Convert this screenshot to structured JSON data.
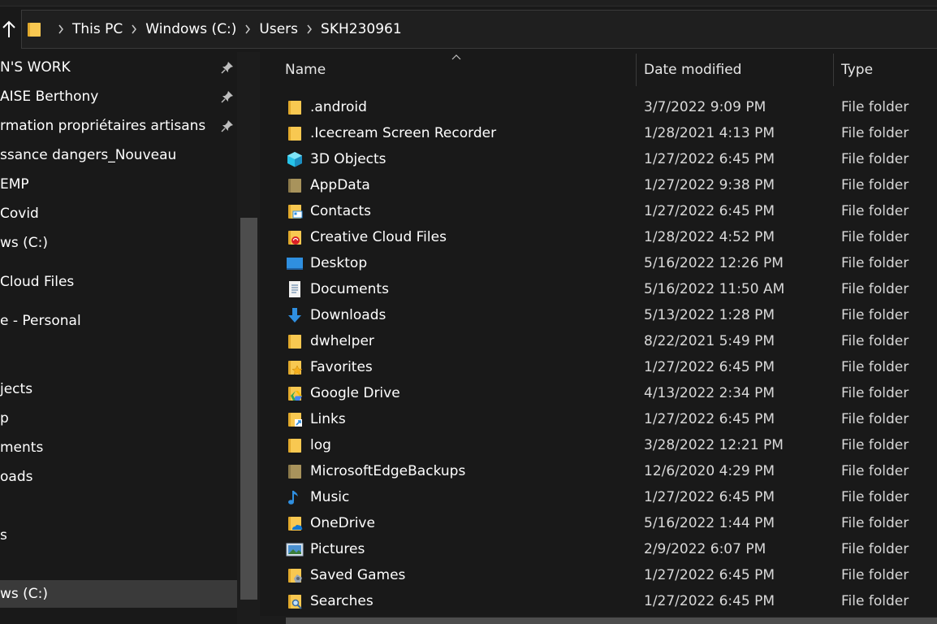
{
  "address_bar": {
    "breadcrumbs": [
      "This PC",
      "Windows (C:)",
      "Users",
      "SKH230961"
    ]
  },
  "nav": {
    "items": [
      {
        "label": "N'S WORK",
        "pinned": true
      },
      {
        "label": "AISE Berthony",
        "pinned": true
      },
      {
        "label": "rmation propriétaires artisans",
        "pinned": true
      },
      {
        "label": "ssance dangers_Nouveau",
        "pinned": false
      },
      {
        "label": "EMP",
        "pinned": false
      },
      {
        "label": "Covid",
        "pinned": false
      },
      {
        "label": "ws (C:)",
        "pinned": false
      },
      {
        "label": "Cloud Files",
        "pinned": false
      },
      {
        "label": "e - Personal",
        "pinned": false
      },
      {
        "label": "jects",
        "pinned": false
      },
      {
        "label": "p",
        "pinned": false
      },
      {
        "label": "ments",
        "pinned": false
      },
      {
        "label": "oads",
        "pinned": false
      },
      {
        "label": "s",
        "pinned": false
      },
      {
        "label": "ws (C:)",
        "pinned": false,
        "selected": true
      }
    ]
  },
  "columns": {
    "name": "Name",
    "date_modified": "Date modified",
    "type": "Type"
  },
  "files": [
    {
      "name": ".android",
      "date": "3/7/2022 9:09 PM",
      "type": "File folder",
      "icon": "folder-icon"
    },
    {
      "name": ".Icecream Screen Recorder",
      "date": "1/28/2021 4:13 PM",
      "type": "File folder",
      "icon": "folder-icon"
    },
    {
      "name": "3D Objects",
      "date": "1/27/2022 6:45 PM",
      "type": "File folder",
      "icon": "3d-objects-icon"
    },
    {
      "name": "AppData",
      "date": "1/27/2022 9:38 PM",
      "type": "File folder",
      "icon": "hidden-folder-icon"
    },
    {
      "name": "Contacts",
      "date": "1/27/2022 6:45 PM",
      "type": "File folder",
      "icon": "contacts-folder-icon"
    },
    {
      "name": "Creative Cloud Files",
      "date": "1/28/2022 4:52 PM",
      "type": "File folder",
      "icon": "creative-cloud-folder-icon"
    },
    {
      "name": "Desktop",
      "date": "5/16/2022 12:26 PM",
      "type": "File folder",
      "icon": "desktop-icon"
    },
    {
      "name": "Documents",
      "date": "5/16/2022 11:50 AM",
      "type": "File folder",
      "icon": "documents-icon"
    },
    {
      "name": "Downloads",
      "date": "5/13/2022 1:28 PM",
      "type": "File folder",
      "icon": "download-arrow-icon"
    },
    {
      "name": "dwhelper",
      "date": "8/22/2021 5:49 PM",
      "type": "File folder",
      "icon": "folder-icon"
    },
    {
      "name": "Favorites",
      "date": "1/27/2022 6:45 PM",
      "type": "File folder",
      "icon": "favorites-star-folder-icon"
    },
    {
      "name": "Google Drive",
      "date": "4/13/2022 2:34 PM",
      "type": "File folder",
      "icon": "google-drive-folder-icon"
    },
    {
      "name": "Links",
      "date": "1/27/2022 6:45 PM",
      "type": "File folder",
      "icon": "links-folder-icon"
    },
    {
      "name": "log",
      "date": "3/28/2022 12:21 PM",
      "type": "File folder",
      "icon": "folder-icon"
    },
    {
      "name": "MicrosoftEdgeBackups",
      "date": "12/6/2020 4:29 PM",
      "type": "File folder",
      "icon": "hidden-folder-icon"
    },
    {
      "name": "Music",
      "date": "1/27/2022 6:45 PM",
      "type": "File folder",
      "icon": "music-note-icon"
    },
    {
      "name": "OneDrive",
      "date": "5/16/2022 1:44 PM",
      "type": "File folder",
      "icon": "onedrive-folder-icon"
    },
    {
      "name": "Pictures",
      "date": "2/9/2022 6:07 PM",
      "type": "File folder",
      "icon": "pictures-icon"
    },
    {
      "name": "Saved Games",
      "date": "1/27/2022 6:45 PM",
      "type": "File folder",
      "icon": "saved-games-folder-icon"
    },
    {
      "name": "Searches",
      "date": "1/27/2022 6:45 PM",
      "type": "File folder",
      "icon": "search-folder-icon"
    }
  ],
  "colors": {
    "background": "#191919",
    "folder_yellow": "#f8c851",
    "folder_yellow_dark": "#e1a92c",
    "accent_blue": "#2f8fe0",
    "selected_bg": "#3a3a3a"
  }
}
